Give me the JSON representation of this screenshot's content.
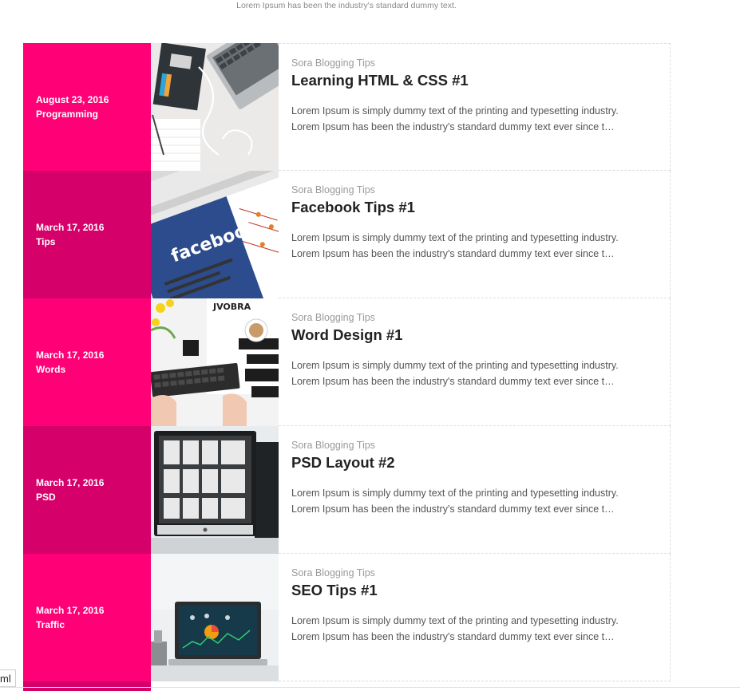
{
  "header": {
    "subtitle": "Lorem Ipsum has been the industry's standard dummy text."
  },
  "colors": {
    "pink_light": "#ff0077",
    "pink_dark": "#d6006a"
  },
  "posts": [
    {
      "date": "August 23, 2016",
      "label": "Programming",
      "author": "Sora Blogging Tips",
      "title": "Learning HTML & CSS #1",
      "excerpt_1": "Lorem Ipsum is simply dummy text of the printing and typesetting industry.",
      "excerpt_2": "Lorem Ipsum has been the industry's standard dummy text ever since t…",
      "thumb_icon": "book-laptop-image"
    },
    {
      "date": "March 17, 2016",
      "label": "Tips",
      "author": "Sora Blogging Tips",
      "title": "Facebook Tips #1",
      "excerpt_1": "Lorem Ipsum is simply dummy text of the printing and typesetting industry.",
      "excerpt_2": "Lorem Ipsum has been the industry's standard dummy text ever since t…",
      "thumb_icon": "facebook-screen-image",
      "thumb_text": "facebook"
    },
    {
      "date": "March 17, 2016",
      "label": "Words",
      "author": "Sora Blogging Tips",
      "title": "Word Design #1",
      "excerpt_1": "Lorem Ipsum is simply dummy text of the printing and typesetting industry.",
      "excerpt_2": "Lorem Ipsum has been the industry's standard dummy text ever since t…",
      "thumb_icon": "keyboard-desk-image"
    },
    {
      "date": "March 17, 2016",
      "label": "PSD",
      "author": "Sora Blogging Tips",
      "title": "PSD Layout #2",
      "excerpt_1": "Lorem Ipsum is simply dummy text of the printing and typesetting industry.",
      "excerpt_2": "Lorem Ipsum has been the industry's standard dummy text ever since t…",
      "thumb_icon": "monitor-layout-image"
    },
    {
      "date": "March 17, 2016",
      "label": "Traffic",
      "author": "Sora Blogging Tips",
      "title": "SEO Tips #1",
      "excerpt_1": "Lorem Ipsum is simply dummy text of the printing and typesetting industry.",
      "excerpt_2": "Lorem Ipsum has been the industry's standard dummy text ever since t…",
      "thumb_icon": "laptop-analytics-image"
    }
  ],
  "tab_fragment": "ml"
}
